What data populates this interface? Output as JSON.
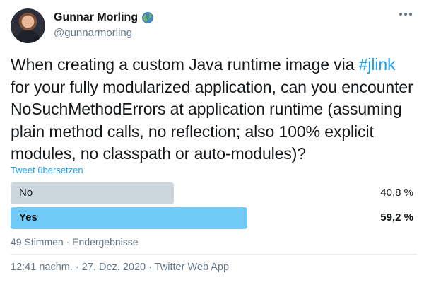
{
  "author": {
    "name": "Gunnar Morling",
    "handle": "@gunnarmorling",
    "badge_icon": "globe-icon"
  },
  "tweet": {
    "text_before": "When creating a custom Java runtime image via ",
    "hashtag": "#jlink",
    "text_after": " for your fully modularized application, can you encounter NoSuchMethodErrors at application runtime (assuming plain method calls, no reflection; also 100% explicit modules, no classpath or auto-modules)?",
    "translate_label": "Tweet übersetzen"
  },
  "poll": {
    "choices": [
      {
        "label": "No",
        "percent_label": "40,8 %",
        "fraction": 0.408,
        "color": "#ccd6dd",
        "winner": false
      },
      {
        "label": "Yes",
        "percent_label": "59,2 %",
        "fraction": 0.592,
        "color": "#71c9f8",
        "winner": true
      }
    ],
    "votes": "49 Stimmen",
    "separator": "·",
    "status": "Endergebnisse"
  },
  "meta": {
    "time": "12:41 nachm.",
    "date": "27. Dez. 2020",
    "source": "Twitter Web App",
    "separator": "·"
  },
  "colors": {
    "accent": "#1da1f2",
    "text": "#14171a",
    "secondary": "#657786"
  }
}
